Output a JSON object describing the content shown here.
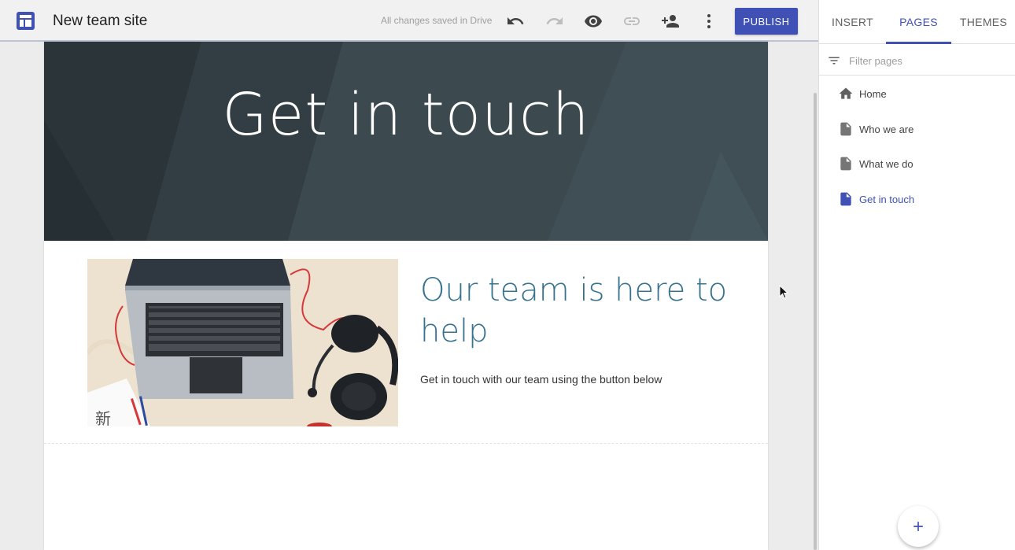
{
  "app": {
    "site_title": "New team site",
    "save_status": "All changes saved in Drive",
    "publish_label": "PUBLISH",
    "accent_color": "#3f51b5"
  },
  "toolbar": {
    "icons": [
      "undo-icon",
      "redo-icon",
      "preview-icon",
      "link-icon",
      "share-icon",
      "more-icon"
    ]
  },
  "canvas": {
    "hero_title": "Get in touch",
    "headline": "Our team is here to help",
    "body_text": "Get in touch with our team using the button below",
    "photo_caption_text": "新"
  },
  "panel": {
    "tabs": [
      {
        "label": "INSERT",
        "active": false
      },
      {
        "label": "PAGES",
        "active": true
      },
      {
        "label": "THEMES",
        "active": false
      }
    ],
    "filter_placeholder": "Filter pages",
    "pages": [
      {
        "label": "Home",
        "icon": "home-icon",
        "active": false
      },
      {
        "label": "Who we are",
        "icon": "page-icon",
        "active": false
      },
      {
        "label": "What we do",
        "icon": "page-icon",
        "active": false
      },
      {
        "label": "Get in touch",
        "icon": "page-icon",
        "active": true
      }
    ],
    "fab_icon": "add-icon"
  }
}
